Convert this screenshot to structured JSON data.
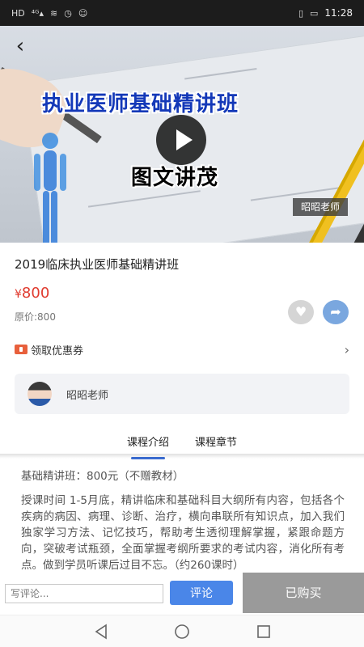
{
  "status_bar": {
    "left_icons": [
      "HD",
      "4G",
      "wifi",
      "alarm",
      "face-id"
    ],
    "time": "11:28"
  },
  "banner": {
    "title": "执业医师基础精讲班",
    "subtitle": "图文讲茂",
    "teacher_tag": "昭昭老师"
  },
  "course": {
    "title": "2019临床执业医师基础精讲班",
    "currency": "¥",
    "price": "800",
    "original_price": "原价:800"
  },
  "coupon": {
    "label": "领取优惠券"
  },
  "teacher": {
    "name": "昭昭老师"
  },
  "tabs": [
    {
      "label": "课程介绍",
      "active": true
    },
    {
      "label": "课程章节",
      "active": false
    }
  ],
  "content": {
    "line1": "基础精讲班：800元（不赠教材）",
    "paragraph": "授课时间 1-5月底，精讲临床和基础科目大纲所有内容，包括各个疾病的病因、病理、诊断、治疗，横向串联所有知识点，加入我们独家学习方法、记忆技巧，帮助考生透彻理解掌握，紧跟命题方向，突破考试瓶颈，全面掌握考纲所要求的考试内容，消化所有考点。做到学员听课后过目不忘。（约260课时）"
  },
  "bottom_bar": {
    "comment_placeholder": "写评论...",
    "comment_button": "评论",
    "buy_button": "已购买"
  },
  "colors": {
    "price": "#e03a2e",
    "accent": "#4a86e8",
    "tab_indicator": "#3a6cd2",
    "buy_disabled": "#9a9a9a"
  }
}
